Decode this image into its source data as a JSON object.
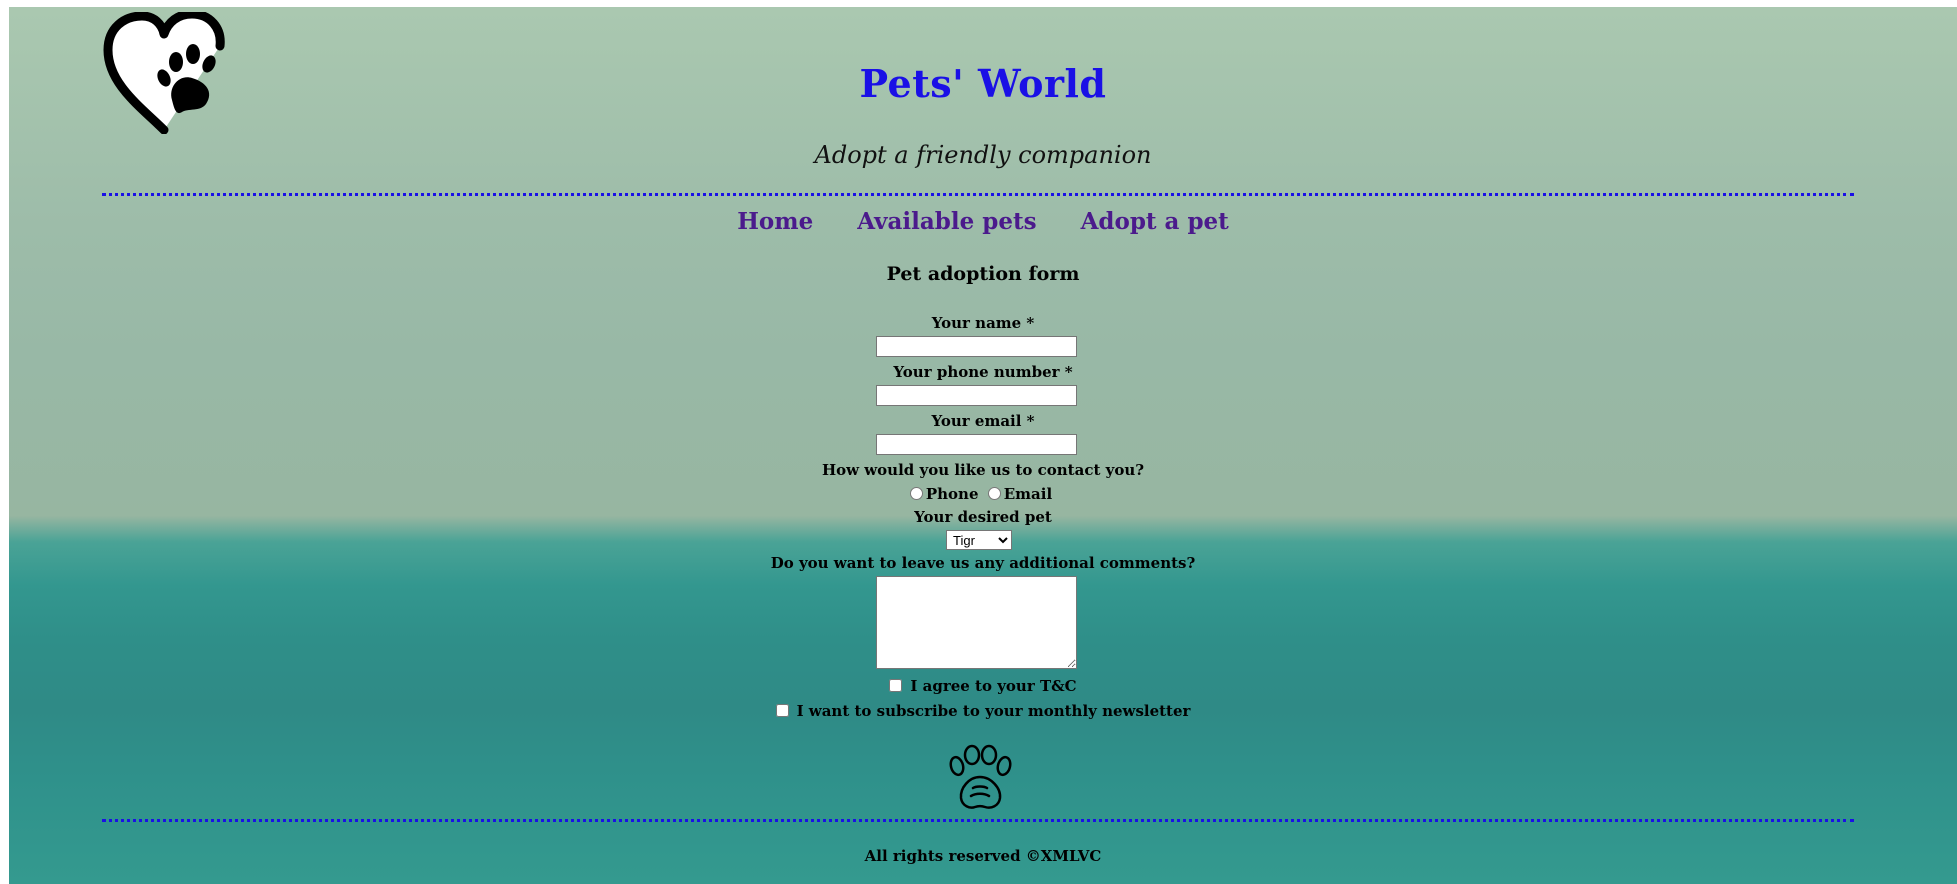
{
  "header": {
    "title": "Pets' World",
    "tagline": "Adopt a friendly companion"
  },
  "nav": {
    "items": [
      {
        "label": "Home"
      },
      {
        "label": "Available pets"
      },
      {
        "label": "Adopt a pet"
      }
    ]
  },
  "form": {
    "title": "Pet adoption form",
    "name_label": "Your name *",
    "name_value": "",
    "phone_label": "Your phone number *",
    "phone_value": "",
    "email_label": "Your email *",
    "email_value": "",
    "contact_label": "How would you like us to contact you?",
    "contact_options": [
      "Phone",
      "Email"
    ],
    "pet_label": "Your desired pet",
    "pet_selected": "Tigr",
    "comments_label": "Do you want to leave us any additional comments?",
    "comments_value": "",
    "tc_label": "I agree to your T&C",
    "newsletter_label": "I want to subscribe to your monthly newsletter"
  },
  "footer": {
    "text": "All rights reserved ©XMLVC"
  },
  "icons": {
    "logo": "heart-paw-icon",
    "paw": "paw-outline-icon"
  },
  "colors": {
    "title": "#1a10e6",
    "nav_link": "#4b1a8c",
    "divider": "#1a10e6"
  }
}
